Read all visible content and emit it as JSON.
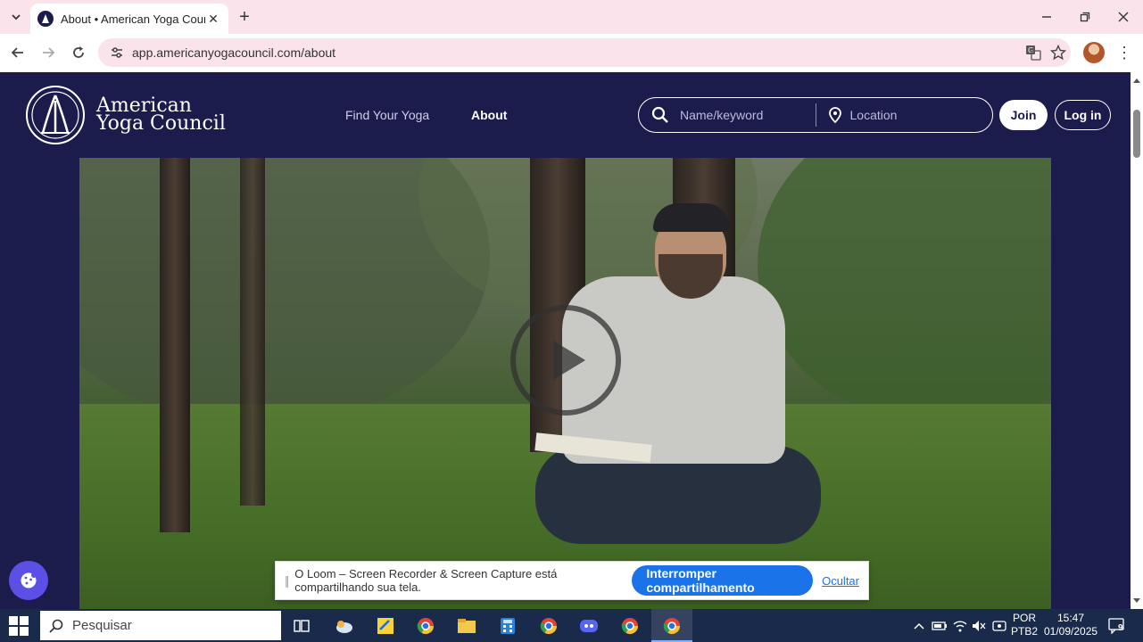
{
  "browser": {
    "tab": {
      "title": "About • American Yoga Council",
      "favicon": "ayc-logo-icon"
    },
    "url": "app.americanyogacouncil.com/about",
    "icons": [
      "back-icon",
      "forward-icon",
      "reload-icon",
      "site-settings-icon",
      "translate-icon",
      "bookmark-star-icon",
      "profile-avatar",
      "menu-kebab-icon"
    ]
  },
  "site": {
    "logo": {
      "line1": "American",
      "line2": "Yoga Council"
    },
    "nav": {
      "find": "Find Your Yoga",
      "about": "About"
    },
    "search": {
      "keyword_placeholder": "Name/keyword",
      "location_placeholder": "Location"
    },
    "buttons": {
      "join": "Join",
      "login": "Log in"
    },
    "colors": {
      "header_bg": "#1b1b4c",
      "accent": "#5b4fe6"
    }
  },
  "video": {
    "state": "paused",
    "icon": "play-icon"
  },
  "loom": {
    "message": "O Loom – Screen Recorder & Screen Capture está compartilhando sua tela.",
    "stop_label": "Interromper compartilhamento",
    "hide_label": "Ocultar"
  },
  "taskbar": {
    "search_label": "Pesquisar",
    "lang_line1": "POR",
    "lang_line2": "PTB2",
    "time": "15:47",
    "date": "01/09/2025",
    "notification_count": "9"
  }
}
